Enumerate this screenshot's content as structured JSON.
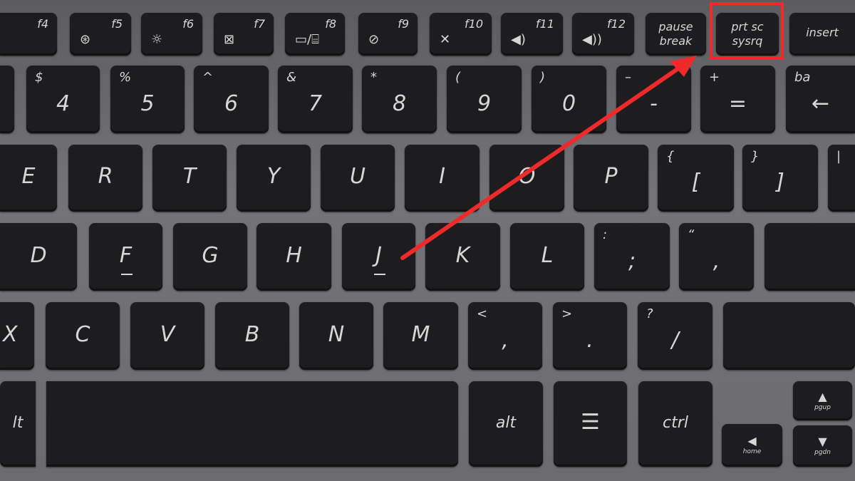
{
  "colors": {
    "key": "#1d1d1f",
    "deck": "#6e6e72",
    "legend": "#d6d6d6",
    "annotation": "#ee2a2a"
  },
  "highlighted_key": "prt sc sysrq",
  "keys": [
    {
      "fn": "f4"
    },
    {
      "fn": "f5",
      "icon": "⊛"
    },
    {
      "fn": "f6",
      "icon": "☼"
    },
    {
      "fn": "f7",
      "icon": "⊠"
    },
    {
      "fn": "f8",
      "icon": "▭/⌸"
    },
    {
      "fn": "f9",
      "icon": "⊘"
    },
    {
      "fn": "f10",
      "icon": "✕"
    },
    {
      "fn": "f11",
      "icon": "◀)"
    },
    {
      "fn": "f12",
      "icon": "◀))"
    },
    {
      "text": "pause\nbreak"
    },
    {
      "text": "prt sc\nsysrq"
    },
    {
      "text": "insert"
    },
    {
      "main": "",
      "sec": ""
    },
    {
      "main": "4",
      "sec": "$"
    },
    {
      "main": "5",
      "sec": "%"
    },
    {
      "main": "6",
      "sec": "^"
    },
    {
      "main": "7",
      "sec": "&"
    },
    {
      "main": "8",
      "sec": "*"
    },
    {
      "main": "9",
      "sec": "("
    },
    {
      "main": "0",
      "sec": ")"
    },
    {
      "main": "-",
      "sec": "–"
    },
    {
      "main": "=",
      "sec": "+"
    },
    {
      "main": "←",
      "sec": "ba"
    },
    {
      "main": "E"
    },
    {
      "main": "R"
    },
    {
      "main": "T"
    },
    {
      "main": "Y"
    },
    {
      "main": "U"
    },
    {
      "main": "I"
    },
    {
      "main": "O"
    },
    {
      "main": "P"
    },
    {
      "main": "[",
      "sec": "{"
    },
    {
      "main": "]",
      "sec": "}"
    },
    {
      "main": "",
      "sec": "|"
    },
    {
      "main": "D"
    },
    {
      "main": "F"
    },
    {
      "main": "G"
    },
    {
      "main": "H"
    },
    {
      "main": "J"
    },
    {
      "main": "K"
    },
    {
      "main": "L"
    },
    {
      "main": ";",
      "sec": ":"
    },
    {
      "main": ",",
      "sec": "“"
    },
    {
      "main": ""
    },
    {
      "main": "X"
    },
    {
      "main": "C"
    },
    {
      "main": "V"
    },
    {
      "main": "B"
    },
    {
      "main": "N"
    },
    {
      "main": "M"
    },
    {
      "main": ",",
      "sec": "<"
    },
    {
      "main": ".",
      "sec": ">"
    },
    {
      "main": "/",
      "sec": "?"
    },
    {
      "main": ""
    },
    {
      "main": "lt"
    },
    {
      "main": ""
    },
    {
      "main": "alt"
    },
    {
      "main": "☰"
    },
    {
      "main": "ctrl"
    },
    {
      "main": "◀",
      "label": "home"
    },
    {
      "main": "▲",
      "label": "pgup"
    },
    {
      "main": "▼",
      "label": "pgdn"
    }
  ]
}
